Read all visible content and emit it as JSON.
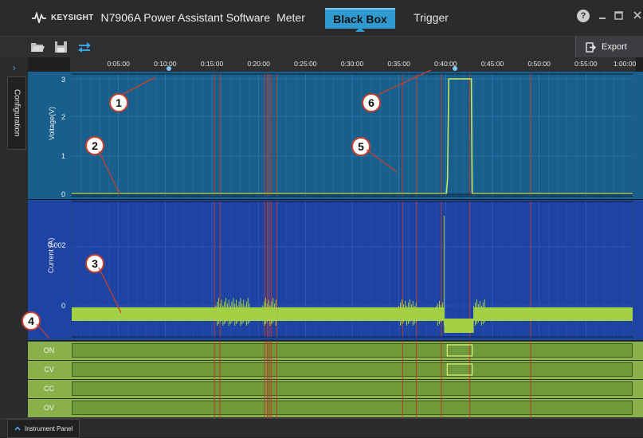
{
  "app": {
    "brand": "KEYSIGHT",
    "title": "N7906A Power Assistant Software",
    "tabs": [
      {
        "label": "Meter",
        "active": false
      },
      {
        "label": "Black Box",
        "active": true
      },
      {
        "label": "Trigger",
        "active": false
      }
    ],
    "help_glyph": "?",
    "window_buttons": [
      "minimize",
      "maximize",
      "close"
    ]
  },
  "toolbar": {
    "icons": [
      "open-folder-icon",
      "save-icon",
      "swap-arrows-icon"
    ],
    "export_label": "Export"
  },
  "sidebar": {
    "tab_label": "Configuration"
  },
  "timeline": {
    "ticks": [
      "0:05:00",
      "0:10:00",
      "0:15:00",
      "0:20:00",
      "0:25:00",
      "0:30:00",
      "0:35:00",
      "0:40:00",
      "0:45:00",
      "0:50:00",
      "0:55:00",
      "1:00:00"
    ],
    "marker_times_sec": [
      625,
      2460
    ]
  },
  "voltage_panel": {
    "ylabel": "Voltage(V)",
    "yticks": [
      "3",
      "2",
      "1",
      "0"
    ]
  },
  "current_panel": {
    "ylabel": "Current (A)",
    "yticks": [
      "0.002",
      "0"
    ]
  },
  "digital_panel": {
    "rows": [
      "ON",
      "CV",
      "CC",
      "OV"
    ]
  },
  "event_lines_sec": [
    916,
    952,
    1238,
    1256,
    1268,
    1280,
    1316,
    2124,
    2212,
    2372,
    2555,
    2946
  ],
  "callouts": [
    "1",
    "2",
    "3",
    "4",
    "5",
    "6"
  ],
  "statusbar": {
    "instrument_panel_label": "Instrument Panel"
  },
  "colors": {
    "voltage_bg": "#195f8e",
    "current_bg": "#1d43a3",
    "trace": "#c8e65a",
    "current_band": "#a4d046",
    "event_line": "#c0392b",
    "digital_row": "#8ab04b",
    "active_tab": "#2f9ad0"
  }
}
